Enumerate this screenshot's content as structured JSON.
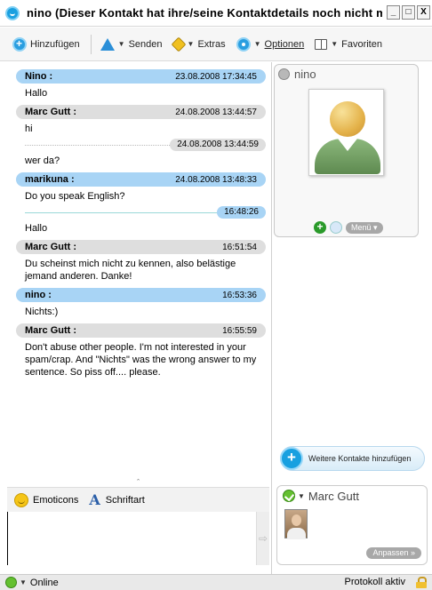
{
  "window": {
    "title": "nino (Dieser Kontakt hat ihre/seine Kontaktdetails noch nicht mi...",
    "minimize": "_",
    "maximize": "□",
    "close": "X"
  },
  "toolbar": {
    "add_label": "Hinzufügen",
    "send_label": "Senden",
    "extras_label": "Extras",
    "options_label": "Optionen",
    "favorites_label": "Favoriten"
  },
  "messages": [
    {
      "sender": "Nino :",
      "time": "23.08.2008 17:34:45",
      "style": "blue",
      "lines": [
        {
          "text": "Hallo"
        }
      ]
    },
    {
      "sender": "Marc Gutt :",
      "time": "24.08.2008 13:44:57",
      "style": "gray",
      "lines": [
        {
          "text": "hi"
        },
        {
          "ts": "24.08.2008 13:44:59",
          "ts_style": "gray"
        },
        {
          "text": "wer da?"
        }
      ]
    },
    {
      "sender": "marikuna :",
      "time": "24.08.2008 13:48:33",
      "style": "blue",
      "lines": [
        {
          "text": "Do you speak English?"
        },
        {
          "ts": "16:48:26",
          "ts_style": "blue"
        },
        {
          "text": "Hallo"
        }
      ]
    },
    {
      "sender": "Marc Gutt :",
      "time": "16:51:54",
      "style": "gray",
      "lines": [
        {
          "text": "Du scheinst mich nicht zu kennen, also belästige jemand anderen. Danke!"
        }
      ]
    },
    {
      "sender": "nino :",
      "time": "16:53:36",
      "style": "blue",
      "lines": [
        {
          "text": "Nichts:)"
        }
      ]
    },
    {
      "sender": "Marc Gutt :",
      "time": "16:55:59",
      "style": "gray",
      "lines": [
        {
          "text": "Don't abuse other people. I'm not interested in your spam/crap. And \"Nichts\" was the wrong answer to my sentence. So piss off.... please."
        }
      ]
    }
  ],
  "compose": {
    "emoticons_label": "Emoticons",
    "font_label": "Schriftart",
    "text": ""
  },
  "contact": {
    "name": "nino",
    "menu_label": "Menü ▾"
  },
  "add_contacts_label": "Weitere Kontakte hinzufügen",
  "self": {
    "name": "Marc Gutt",
    "customize_label": "Anpassen »"
  },
  "statusbar": {
    "status": "Online",
    "protocol": "Protokoll aktiv"
  },
  "colors": {
    "accent_blue": "#a8d4f5",
    "header_gray": "#dedede",
    "online_green": "#64c030"
  }
}
